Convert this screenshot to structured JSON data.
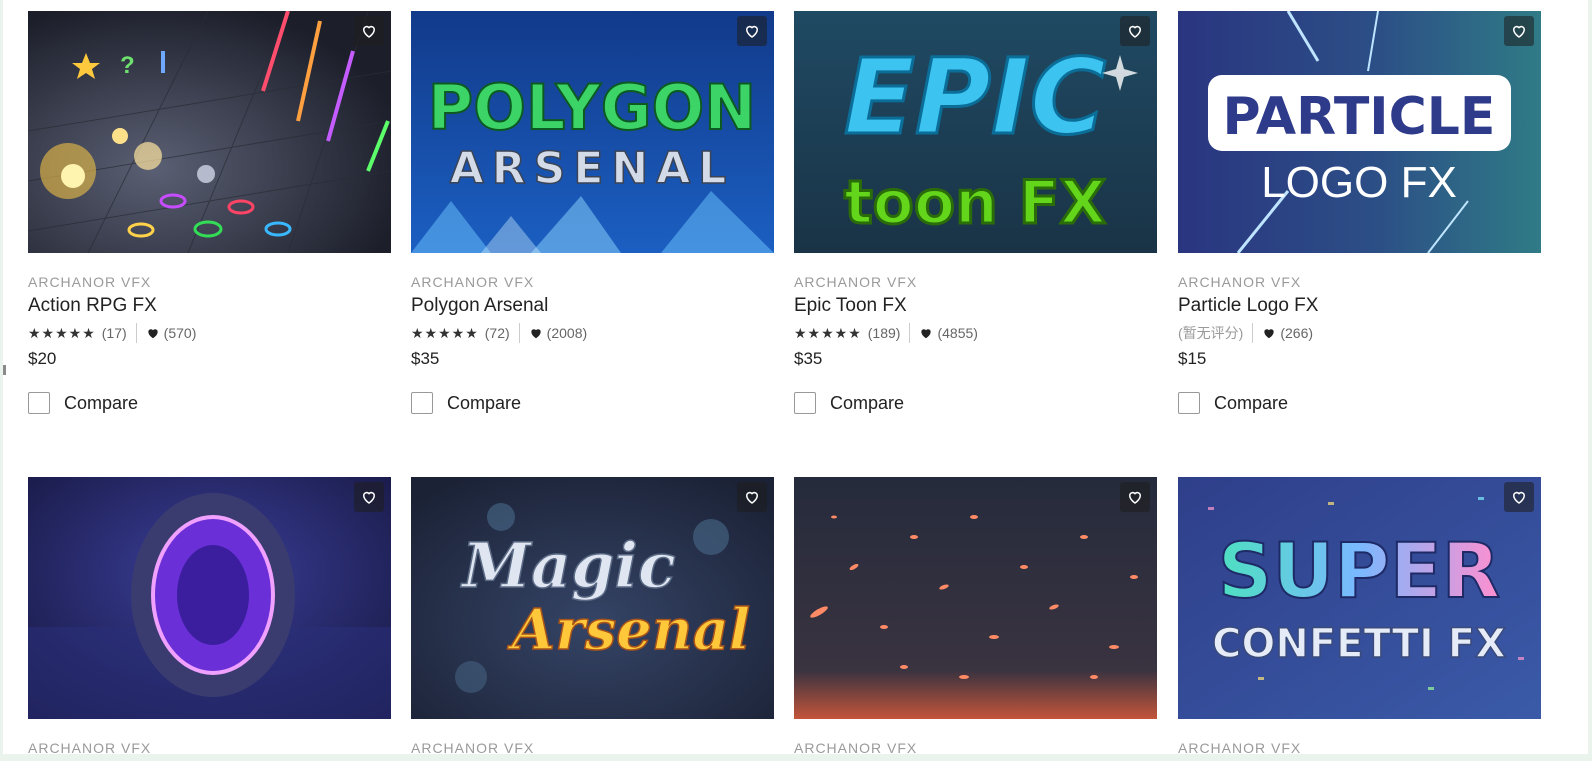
{
  "products": [
    {
      "publisher": "ARCHANOR VFX",
      "title": "Action RPG FX",
      "stars": "★★★★★",
      "rating_count": "(17)",
      "favorites": "(570)",
      "price": "$20",
      "compare_label": "Compare"
    },
    {
      "publisher": "ARCHANOR VFX",
      "title": "Polygon Arsenal",
      "stars": "★★★★★",
      "rating_count": "(72)",
      "favorites": "(2008)",
      "price": "$35",
      "compare_label": "Compare",
      "art_line1": "POLYGON",
      "art_line2": "ARSENAL"
    },
    {
      "publisher": "ARCHANOR VFX",
      "title": "Epic Toon FX",
      "stars": "★★★★★",
      "rating_count": "(189)",
      "favorites": "(4855)",
      "price": "$35",
      "compare_label": "Compare",
      "art_line1": "EPIC",
      "art_line2": "toon FX"
    },
    {
      "publisher": "ARCHANOR VFX",
      "title": "Particle Logo FX",
      "stars": "",
      "rating_count": "(暂无评分)",
      "favorites": "(266)",
      "price": "$15",
      "compare_label": "Compare",
      "art_line1": "PARTICLE",
      "art_line2": "LOGO FX"
    },
    {
      "publisher": "ARCHANOR VFX"
    },
    {
      "publisher": "ARCHANOR VFX",
      "art_line1": "Magic",
      "art_line2": "Arsenal"
    },
    {
      "publisher": "ARCHANOR VFX"
    },
    {
      "publisher": "ARCHANOR VFX",
      "art_line1": "SUPER",
      "art_line2": "CONFETTI FX"
    }
  ],
  "icons": {
    "favorite": "heart-outline-icon",
    "favorites_count": "heart-filled-icon",
    "rating": "star-icon"
  }
}
